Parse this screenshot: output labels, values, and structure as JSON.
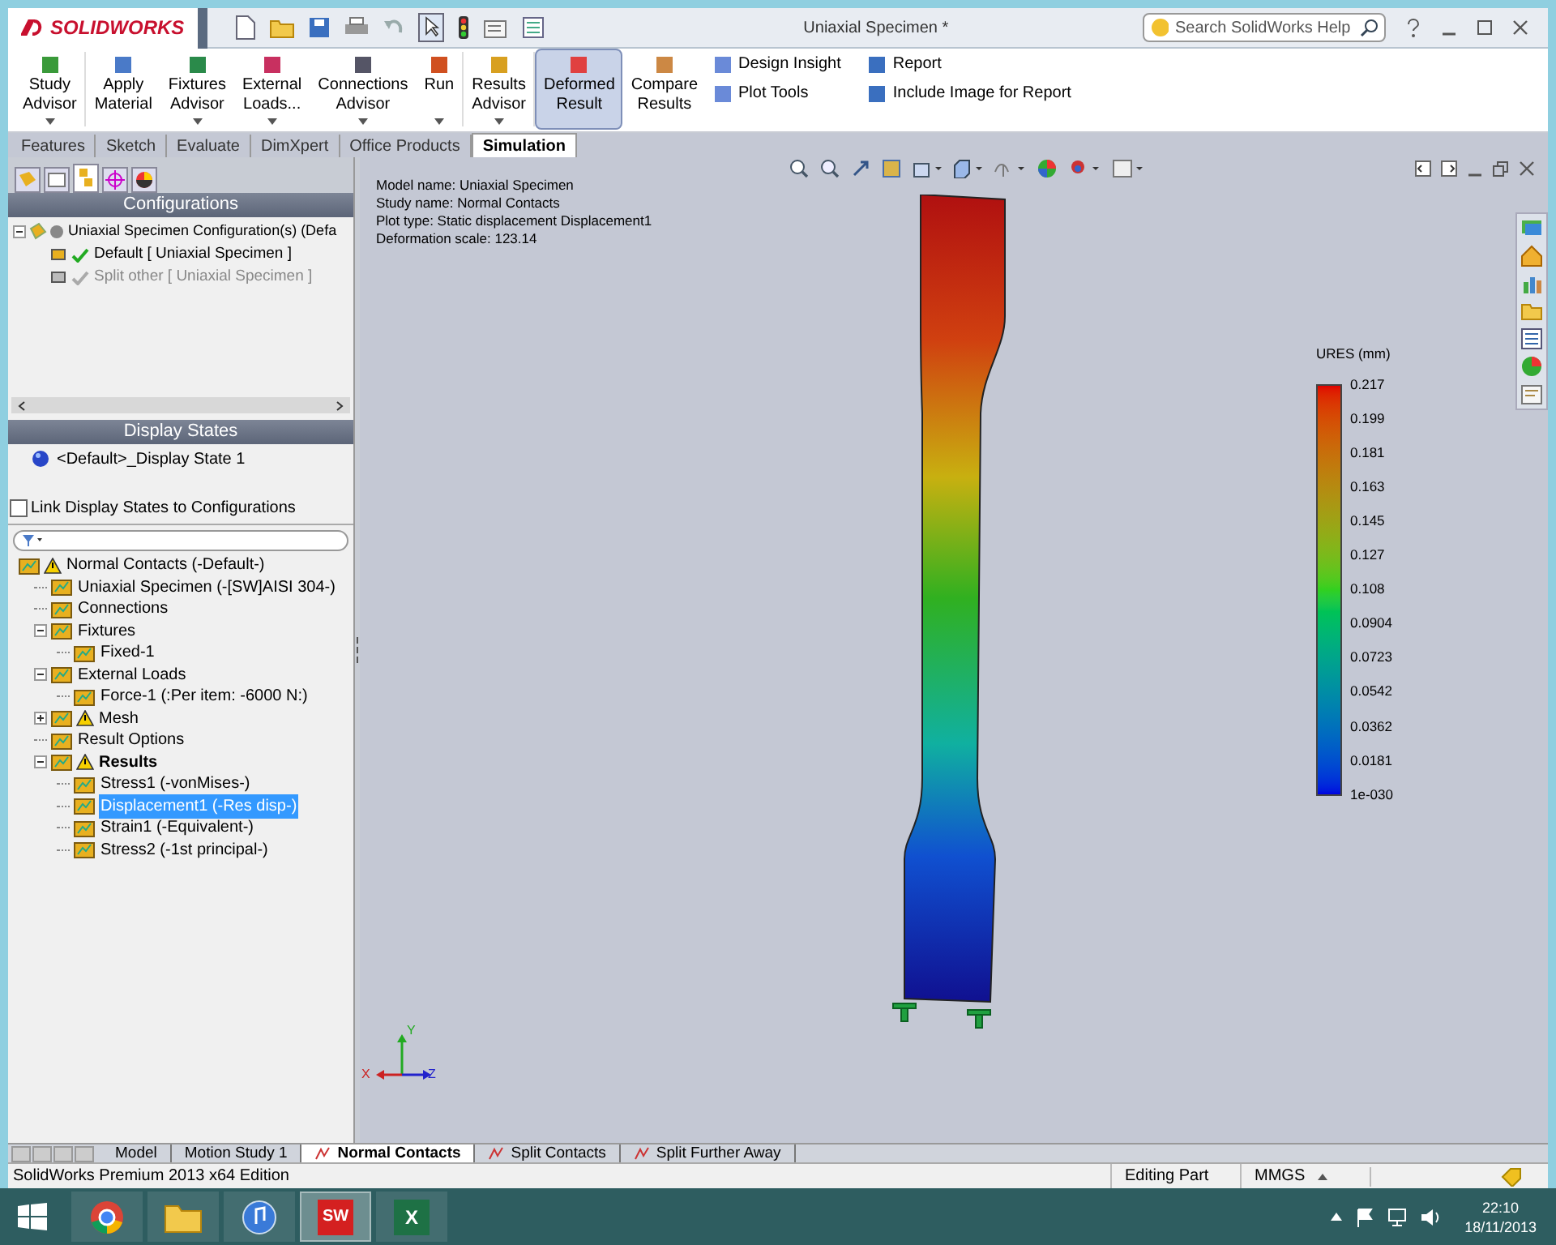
{
  "app": {
    "logo": "SOLIDWORKS",
    "title": "Uniaxial Specimen *",
    "search_placeholder": "Search SolidWorks Help"
  },
  "ribbon": [
    {
      "label": "Study Advisor",
      "dropdown": true,
      "selected": false
    },
    {
      "label": "Apply Material",
      "dropdown": false,
      "selected": false
    },
    {
      "label": "Fixtures Advisor",
      "dropdown": true,
      "selected": false
    },
    {
      "label": "External Loads...",
      "dropdown": true,
      "selected": false
    },
    {
      "label": "Connections Advisor",
      "dropdown": true,
      "selected": false
    },
    {
      "label": "Run",
      "dropdown": true,
      "selected": false
    },
    {
      "label": "Results Advisor",
      "dropdown": true,
      "selected": false
    },
    {
      "label": "Deformed Result",
      "dropdown": false,
      "selected": true
    },
    {
      "label": "Compare Results",
      "dropdown": false,
      "selected": false
    }
  ],
  "ribbon_small": [
    [
      "Design Insight",
      "Plot Tools"
    ],
    [
      "Report",
      "Include Image for Report"
    ]
  ],
  "command_tabs": [
    {
      "label": "Features",
      "selected": false
    },
    {
      "label": "Sketch",
      "selected": false
    },
    {
      "label": "Evaluate",
      "selected": false
    },
    {
      "label": "DimXpert",
      "selected": false
    },
    {
      "label": "Office Products",
      "selected": false
    },
    {
      "label": "Simulation",
      "selected": true
    }
  ],
  "configurations": {
    "title": "Configurations",
    "root": "Uniaxial Specimen Configuration(s)  (Defa",
    "items": [
      {
        "label": "Default [ Uniaxial Specimen ]",
        "active": true
      },
      {
        "label": "Split other [ Uniaxial Specimen ]",
        "active": false
      }
    ]
  },
  "display_states": {
    "title": "Display States",
    "item": "<Default>_Display State 1"
  },
  "link_checkbox": {
    "label": "Link Display States to Configurations",
    "checked": false
  },
  "study_tree": [
    {
      "label": "Normal Contacts (-Default-)",
      "warning": true,
      "bold": false,
      "selected": false,
      "children": [
        {
          "label": "Uniaxial Specimen (-[SW]AISI 304-)",
          "warning": false,
          "bold": false,
          "selected": false
        },
        {
          "label": "Connections",
          "warning": false,
          "bold": false,
          "selected": false
        },
        {
          "label": "Fixtures",
          "warning": false,
          "bold": false,
          "selected": false,
          "expanded": true,
          "children": [
            {
              "label": "Fixed-1",
              "warning": false,
              "bold": false,
              "selected": false
            }
          ]
        },
        {
          "label": "External Loads",
          "warning": false,
          "bold": false,
          "selected": false,
          "expanded": true,
          "children": [
            {
              "label": "Force-1 (:Per item: -6000 N:)",
              "warning": false,
              "bold": false,
              "selected": false
            }
          ]
        },
        {
          "label": "Mesh",
          "warning": true,
          "bold": false,
          "selected": false,
          "expanded": false
        },
        {
          "label": "Result Options",
          "warning": false,
          "bold": false,
          "selected": false
        },
        {
          "label": "Results",
          "warning": true,
          "bold": true,
          "selected": false,
          "expanded": true,
          "children": [
            {
              "label": "Stress1 (-vonMises-)",
              "warning": false,
              "bold": false,
              "selected": false
            },
            {
              "label": "Displacement1 (-Res disp-)",
              "warning": false,
              "bold": false,
              "selected": true
            },
            {
              "label": "Strain1 (-Equivalent-)",
              "warning": false,
              "bold": false,
              "selected": false
            },
            {
              "label": "Stress2 (-1st principal-)",
              "warning": false,
              "bold": false,
              "selected": false
            }
          ]
        }
      ]
    }
  ],
  "plot_info": [
    "Model name: Uniaxial Specimen",
    "Study name: Normal Contacts",
    "Plot type: Static displacement Displacement1",
    "Deformation scale: 123.14"
  ],
  "legend": {
    "title": "URES (mm)",
    "labels": [
      "0.217",
      "0.199",
      "0.181",
      "0.163",
      "0.145",
      "0.127",
      "0.108",
      "0.0904",
      "0.0723",
      "0.0542",
      "0.0362",
      "0.0181",
      "1e-030"
    ]
  },
  "triad": [
    "Y",
    "X",
    "Z"
  ],
  "study_tabs": [
    {
      "label": "Model",
      "selected": false
    },
    {
      "label": "Motion Study 1",
      "selected": false
    },
    {
      "label": "Normal Contacts",
      "selected": true
    },
    {
      "label": "Split Contacts",
      "selected": false
    },
    {
      "label": "Split Further Away",
      "selected": false
    }
  ],
  "status_bar": {
    "edition": "SolidWorks Premium 2013 x64 Edition",
    "mode": "Editing Part",
    "units": "MMGS"
  },
  "taskbar": {
    "apps": [
      {
        "kind": "browser",
        "selected": false
      },
      {
        "kind": "folder",
        "selected": false
      },
      {
        "kind": "music",
        "selected": false
      },
      {
        "kind": "sw",
        "glyph": "SW",
        "selected": true
      },
      {
        "kind": "sheet",
        "glyph": "X",
        "selected": false
      }
    ],
    "time": "22:10",
    "date": "18/11/2013"
  }
}
